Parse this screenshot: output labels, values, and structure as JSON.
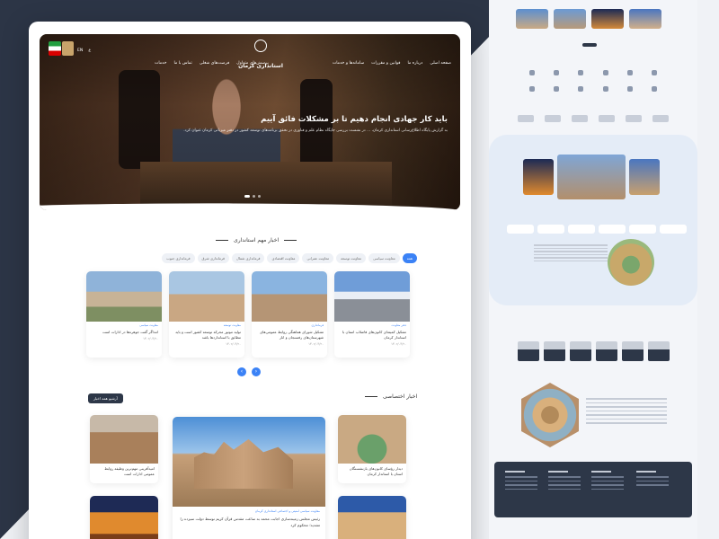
{
  "site": {
    "name": "استانداری کرمان"
  },
  "nav": {
    "right": [
      "صفحه اصلی",
      "درباره ما",
      "قوانین و مقررات",
      "سامانه‌ها و خدمات",
      "مشاغل و فرصت‌های شغلی"
    ],
    "left": [
      "پرسش‌های متداول",
      "فرصت‌های شغلی",
      "تماس با ما",
      "خدمات"
    ],
    "extra": [
      "EN",
      "ع"
    ]
  },
  "hero": {
    "title": "باید کار جهادی انجام دهیم تا بر مشکلات فائق آییم",
    "body": "به گزارش پایگاه اطلاع‌رسانی استانداری کرمان، ... در نشست بررسی جایگاه نظام علم و فناوری در تحقق برنامه‌های توسعه کشور در دفتر میزبانی کرمان عنوان کرد."
  },
  "important_news": {
    "title": "اخبار مهم استانداری",
    "filters": [
      "همه",
      "معاونت سیاسی",
      "معاونت توسعه",
      "معاونت عمرانی",
      "معاونت اقتصادی",
      "فرمانداری شمال",
      "فرمانداری شرق",
      "فرمانداری جنوب",
      "دیگر"
    ],
    "cards": [
      {
        "category": "دفتر معاونت",
        "title": "تشکیل کمیته‌ای کانون‌های فاضلاب استان با استاندار کرمان",
        "meta": "۱۴۰۲/۰۳/۲۰"
      },
      {
        "category": "فرمانداری",
        "title": "تشکیل شورای هماهنگی روابط عمومی‌های شهرستان‌های رفسنجان و انار",
        "meta": "۱۴۰۲/۰۳/۲۰"
      },
      {
        "category": "معاونت توسعه",
        "title": "تولید موتور محرکه توسعه کشور است و باید مطابق با استانداردها باشد",
        "meta": "۱۴۰۲/۰۳/۲۰"
      },
      {
        "category": "معاونت سیاسی",
        "title": "امداگر گفت جوهره‌ها در ادارات است",
        "meta": "۱۴۰۲/۰۳/۲۰"
      }
    ]
  },
  "exclusive": {
    "title": "اخبار اختصاصی",
    "archive_label": "آرشیو همه اخبار",
    "big": {
      "category": "معاونت سیاسی امنیتی و اجتماعی استانداری کرمان",
      "title": "رئیس مجلس زمینه‌سازی اجابت محمد به ساعت مقدس قرآن کریم توسط دولت سیزده را تشدید؛ محکوم کرد"
    },
    "small_right": {
      "title": "دیدار رؤسای کانون‌های بازنشستگان استان با استاندار کرمان"
    },
    "small_left": {
      "title": "امیدآفرینی مهم‌ترین وظیفه روابط عمومی ادارات است"
    }
  },
  "colors": {
    "accent": "#3b82f6",
    "dark": "#2d3748"
  }
}
